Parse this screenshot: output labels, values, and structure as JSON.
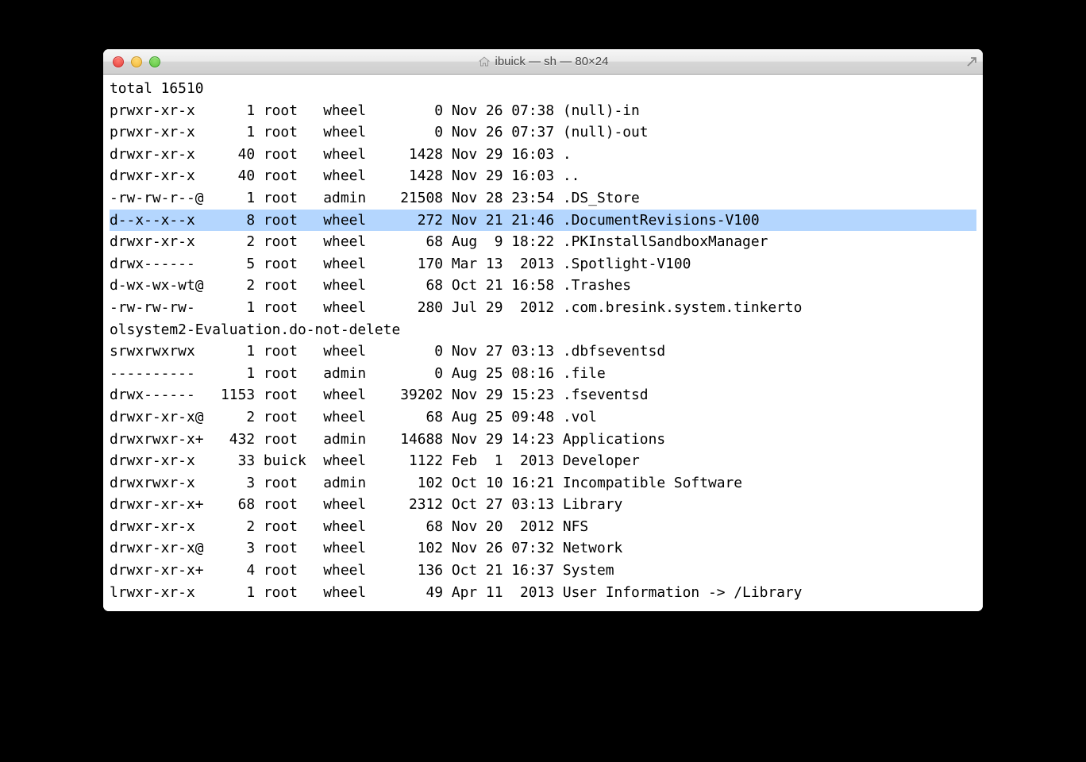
{
  "window": {
    "title": "ibuick — sh — 80×24"
  },
  "terminal": {
    "first_line": "total 16510",
    "highlighted_index": 5,
    "rows": [
      {
        "perm": "prwxr-xr-x ",
        "links": "1",
        "owner": "root ",
        "group": "wheel",
        "size": "0",
        "date": "Nov 26 07:38",
        "name": "(null)-in"
      },
      {
        "perm": "prwxr-xr-x ",
        "links": "1",
        "owner": "root ",
        "group": "wheel",
        "size": "0",
        "date": "Nov 26 07:37",
        "name": "(null)-out"
      },
      {
        "perm": "drwxr-xr-x ",
        "links": "40",
        "owner": "root ",
        "group": "wheel",
        "size": "1428",
        "date": "Nov 29 16:03",
        "name": "."
      },
      {
        "perm": "drwxr-xr-x ",
        "links": "40",
        "owner": "root ",
        "group": "wheel",
        "size": "1428",
        "date": "Nov 29 16:03",
        "name": ".."
      },
      {
        "perm": "-rw-rw-r--@",
        "links": "1",
        "owner": "root ",
        "group": "admin",
        "size": "21508",
        "date": "Nov 28 23:54",
        "name": ".DS_Store"
      },
      {
        "perm": "d--x--x--x ",
        "links": "8",
        "owner": "root ",
        "group": "wheel",
        "size": "272",
        "date": "Nov 21 21:46",
        "name": ".DocumentRevisions-V100"
      },
      {
        "perm": "drwxr-xr-x ",
        "links": "2",
        "owner": "root ",
        "group": "wheel",
        "size": "68",
        "date": "Aug  9 18:22",
        "name": ".PKInstallSandboxManager"
      },
      {
        "perm": "drwx------ ",
        "links": "5",
        "owner": "root ",
        "group": "wheel",
        "size": "170",
        "date": "Mar 13  2013",
        "name": ".Spotlight-V100"
      },
      {
        "perm": "d-wx-wx-wt@",
        "links": "2",
        "owner": "root ",
        "group": "wheel",
        "size": "68",
        "date": "Oct 21 16:58",
        "name": ".Trashes"
      },
      {
        "perm": "-rw-rw-rw- ",
        "links": "1",
        "owner": "root ",
        "group": "wheel",
        "size": "280",
        "date": "Jul 29  2012",
        "name": ".com.bresink.system.tinkerto"
      }
    ],
    "wrap_line": "olsystem2-Evaluation.do-not-delete",
    "rows2": [
      {
        "perm": "srwxrwxrwx ",
        "links": "1",
        "owner": "root ",
        "group": "wheel",
        "size": "0",
        "date": "Nov 27 03:13",
        "name": ".dbfseventsd"
      },
      {
        "perm": "---------- ",
        "links": "1",
        "owner": "root ",
        "group": "admin",
        "size": "0",
        "date": "Aug 25 08:16",
        "name": ".file"
      },
      {
        "perm": "drwx------ ",
        "links": "1153",
        "owner": "root ",
        "group": "wheel",
        "size": "39202",
        "date": "Nov 29 15:23",
        "name": ".fseventsd"
      },
      {
        "perm": "drwxr-xr-x@",
        "links": "2",
        "owner": "root ",
        "group": "wheel",
        "size": "68",
        "date": "Aug 25 09:48",
        "name": ".vol"
      },
      {
        "perm": "drwxrwxr-x+",
        "links": "432",
        "owner": "root ",
        "group": "admin",
        "size": "14688",
        "date": "Nov 29 14:23",
        "name": "Applications"
      },
      {
        "perm": "drwxr-xr-x ",
        "links": "33",
        "owner": "buick",
        "group": "wheel",
        "size": "1122",
        "date": "Feb  1  2013",
        "name": "Developer"
      },
      {
        "perm": "drwxrwxr-x ",
        "links": "3",
        "owner": "root ",
        "group": "admin",
        "size": "102",
        "date": "Oct 10 16:21",
        "name": "Incompatible Software"
      },
      {
        "perm": "drwxr-xr-x+",
        "links": "68",
        "owner": "root ",
        "group": "wheel",
        "size": "2312",
        "date": "Oct 27 03:13",
        "name": "Library"
      },
      {
        "perm": "drwxr-xr-x ",
        "links": "2",
        "owner": "root ",
        "group": "wheel",
        "size": "68",
        "date": "Nov 20  2012",
        "name": "NFS"
      },
      {
        "perm": "drwxr-xr-x@",
        "links": "3",
        "owner": "root ",
        "group": "wheel",
        "size": "102",
        "date": "Nov 26 07:32",
        "name": "Network"
      },
      {
        "perm": "drwxr-xr-x+",
        "links": "4",
        "owner": "root ",
        "group": "wheel",
        "size": "136",
        "date": "Oct 21 16:37",
        "name": "System"
      },
      {
        "perm": "lrwxr-xr-x ",
        "links": "1",
        "owner": "root ",
        "group": "wheel",
        "size": "49",
        "date": "Apr 11  2013",
        "name": "User Information -> /Library"
      }
    ]
  }
}
